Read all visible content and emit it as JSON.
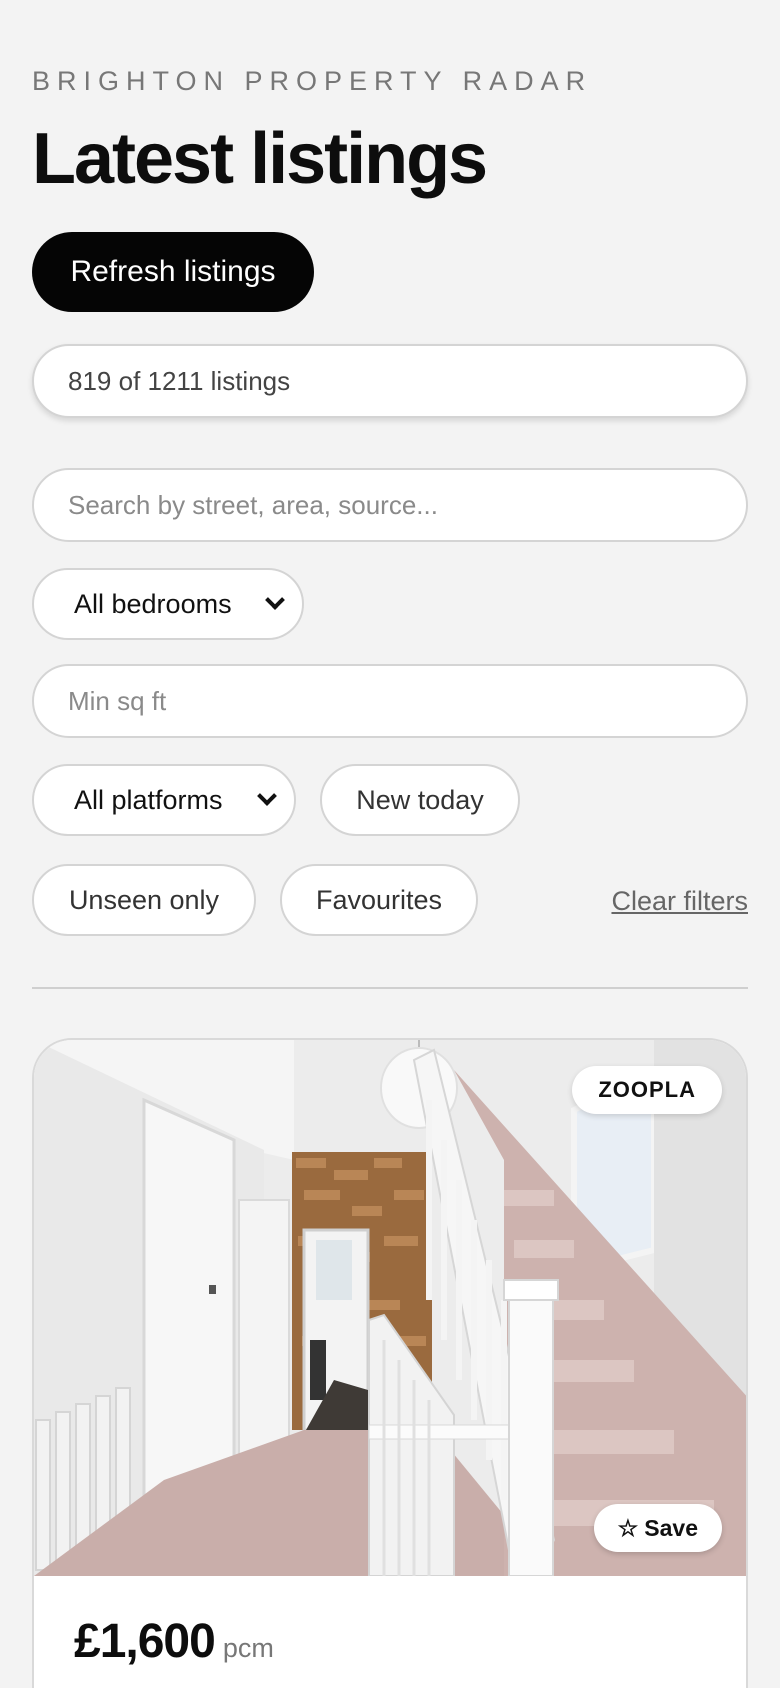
{
  "header": {
    "eyebrow": "BRIGHTON PROPERTY RADAR",
    "title": "Latest listings",
    "refresh_label": "Refresh listings"
  },
  "summary": {
    "count_text": "819 of 1211 listings"
  },
  "filters": {
    "search_placeholder": "Search by street, area, source...",
    "search_value": "",
    "bedrooms_selected": "All bedrooms",
    "min_sqft_placeholder": "Min sq ft",
    "min_sqft_value": "",
    "platform_selected": "All platforms",
    "new_today_label": "New today",
    "unseen_only_label": "Unseen only",
    "favourites_label": "Favourites",
    "clear_label": "Clear filters"
  },
  "listings": [
    {
      "source": "ZOOPLA",
      "save_label": "Save",
      "save_icon": "star-outline-icon",
      "price": "£1,600",
      "price_unit": "pcm"
    }
  ]
}
